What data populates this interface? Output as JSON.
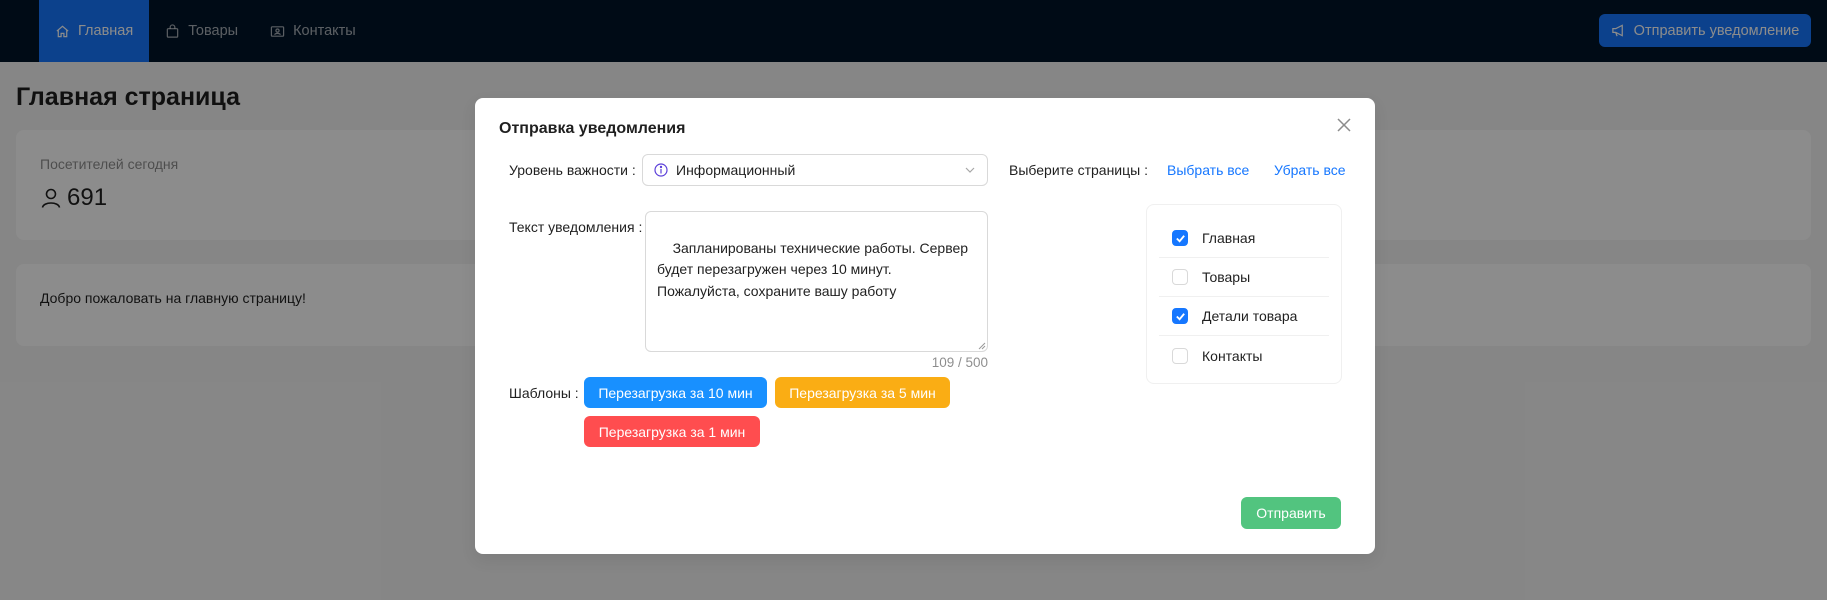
{
  "header": {
    "nav": [
      {
        "label": "Главная",
        "icon": "home-icon",
        "active": true
      },
      {
        "label": "Товары",
        "icon": "shopping-bag-icon",
        "active": false
      },
      {
        "label": "Контакты",
        "icon": "contacts-icon",
        "active": false
      }
    ],
    "notify_button": {
      "label": "Отправить уведомление",
      "icon": "megaphone-icon"
    }
  },
  "page": {
    "title": "Главная страница",
    "stat": {
      "title": "Посетителей сегодня",
      "value": "691",
      "icon": "user-icon"
    },
    "welcome": "Добро пожаловать на главную страницу!"
  },
  "modal": {
    "title": "Отправка уведомления",
    "importance": {
      "label": "Уровень важности",
      "value": "Информационный",
      "icon": "info-circle-icon"
    },
    "text": {
      "label": "Текст уведомления",
      "value": "Запланированы технические работы. Сервер будет перезагружен через 10 минут. Пожалуйста, сохраните вашу работу",
      "counter": "109 / 500"
    },
    "templates": {
      "label": "Шаблоны",
      "items": [
        {
          "label": "Перезагрузка за 10 мин",
          "color": "#1890ff"
        },
        {
          "label": "Перезагрузка за 5 мин",
          "color": "#faad14"
        },
        {
          "label": "Перезагрузка за 1 мин",
          "color": "#ff4d4f"
        }
      ]
    },
    "pages": {
      "label": "Выберите страницы",
      "select_all": "Выбрать все",
      "deselect_all": "Убрать все",
      "items": [
        {
          "label": "Главная",
          "checked": true
        },
        {
          "label": "Товары",
          "checked": false
        },
        {
          "label": "Детали товара",
          "checked": true
        },
        {
          "label": "Контакты",
          "checked": false
        }
      ]
    },
    "send_button": "Отправить"
  },
  "colors": {
    "header_bg": "#001529",
    "primary": "#1677ff",
    "send": "#52c47f",
    "mask": "rgba(0,0,0,0.45)"
  }
}
